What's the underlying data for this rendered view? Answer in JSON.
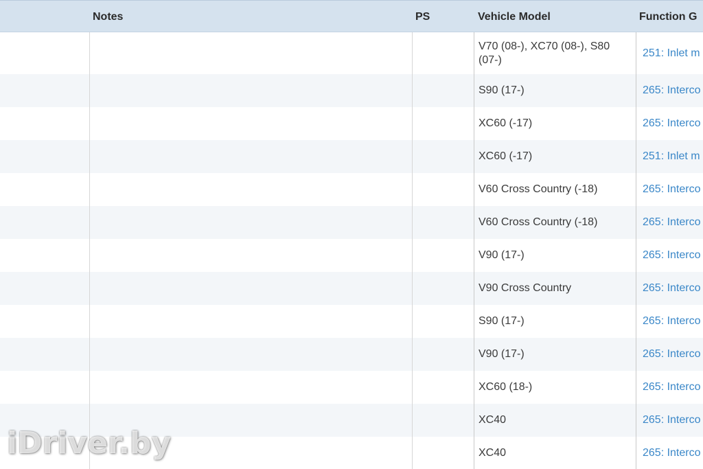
{
  "header": {
    "notes": "Notes",
    "ps": "PS",
    "vehicle_model": "Vehicle Model",
    "function_group": "Function G"
  },
  "rows": [
    {
      "vehicle_model": "V70 (08-), XC70 (08-), S80 (07-)",
      "function_group": "251: Inlet m"
    },
    {
      "vehicle_model": "S90 (17-)",
      "function_group": "265: Interco"
    },
    {
      "vehicle_model": "XC60 (-17)",
      "function_group": "265: Interco"
    },
    {
      "vehicle_model": "XC60 (-17)",
      "function_group": "251: Inlet m"
    },
    {
      "vehicle_model": "V60 Cross Country (-18)",
      "function_group": "265: Interco"
    },
    {
      "vehicle_model": "V60 Cross Country (-18)",
      "function_group": "265: Interco"
    },
    {
      "vehicle_model": "V90 (17-)",
      "function_group": "265: Interco"
    },
    {
      "vehicle_model": "V90 Cross Country",
      "function_group": "265: Interco"
    },
    {
      "vehicle_model": "S90 (17-)",
      "function_group": "265: Interco"
    },
    {
      "vehicle_model": "V90 (17-)",
      "function_group": "265: Interco"
    },
    {
      "vehicle_model": "XC60 (18-)",
      "function_group": "265: Interco"
    },
    {
      "vehicle_model": "XC40",
      "function_group": "265: Interco"
    },
    {
      "vehicle_model": "XC40",
      "function_group": "265: Interco"
    }
  ],
  "watermark": "iDriver.by",
  "colors": {
    "header_bg": "#d5e2ee",
    "alt_row_bg": "#f3f6f9",
    "link": "#3a87c8"
  }
}
